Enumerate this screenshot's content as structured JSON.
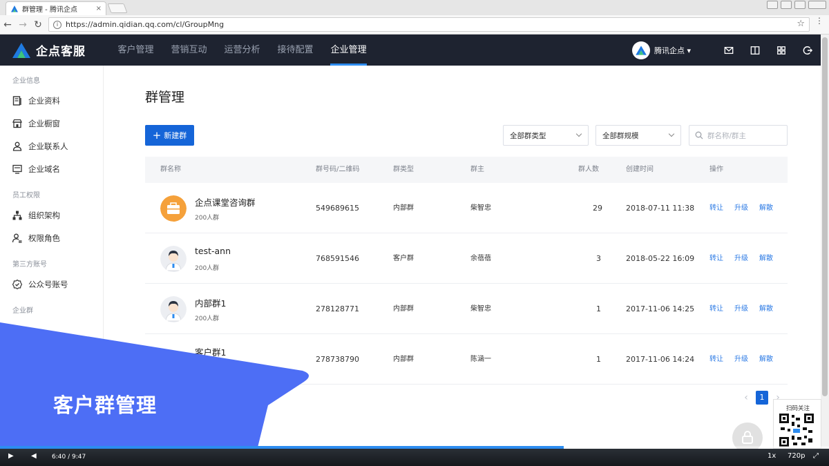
{
  "browser": {
    "tab_title": "群管理 - 腾讯企点",
    "tab_close": "×",
    "url": "https://admin.qidian.qq.com/cl/GroupMng",
    "back": "←",
    "forward": "→",
    "reload": "↻",
    "star": "☆",
    "menu": "⋮"
  },
  "topnav": {
    "brand": "企点客服",
    "items": [
      {
        "label": "客户管理"
      },
      {
        "label": "营销互动"
      },
      {
        "label": "运营分析"
      },
      {
        "label": "接待配置"
      },
      {
        "label": "企业管理"
      }
    ],
    "active_index": 4,
    "user": "腾讯企点 ▾"
  },
  "sidebar": {
    "groups": [
      {
        "title": "企业信息",
        "items": [
          {
            "label": "企业资料",
            "icon": "document-icon"
          },
          {
            "label": "企业橱窗",
            "icon": "storefront-icon"
          },
          {
            "label": "企业联系人",
            "icon": "person-icon"
          },
          {
            "label": "企业域名",
            "icon": "monitor-icon"
          }
        ]
      },
      {
        "title": "员工权限",
        "items": [
          {
            "label": "组织架构",
            "icon": "org-chart-icon"
          },
          {
            "label": "权限角色",
            "icon": "user-role-icon"
          }
        ]
      },
      {
        "title": "第三方账号",
        "items": [
          {
            "label": "公众号账号",
            "icon": "verified-badge-icon"
          }
        ]
      },
      {
        "title": "企业群",
        "items": []
      }
    ]
  },
  "main": {
    "title": "群管理",
    "new_button": "新建群",
    "filter_type": "全部群类型",
    "filter_scale": "全部群规模",
    "search_placeholder": "群名称/群主",
    "columns": [
      "群名称",
      "群号码/二维码",
      "群类型",
      "群主",
      "群人数",
      "创建时间",
      "操作"
    ],
    "rows": [
      {
        "name": "企点课堂咨询群",
        "sub": "200人群",
        "number": "549689615",
        "type": "内部群",
        "owner": "柴智忠",
        "count": "29",
        "created": "2018-07-11 11:38",
        "avatar": "briefcase-avatar"
      },
      {
        "name": "test-ann",
        "sub": "200人群",
        "number": "768591546",
        "type": "客户群",
        "owner": "余蓓蓓",
        "count": "3",
        "created": "2018-05-22 16:09",
        "avatar": "person-avatar"
      },
      {
        "name": "内部群1",
        "sub": "200人群",
        "number": "278128771",
        "type": "内部群",
        "owner": "柴智忠",
        "count": "1",
        "created": "2017-11-06 14:25",
        "avatar": "person-avatar"
      },
      {
        "name": "客户群1",
        "sub": "",
        "number": "278738790",
        "type": "内部群",
        "owner": "陈涵一",
        "count": "1",
        "created": "2017-11-06 14:24",
        "avatar": "person-avatar"
      }
    ],
    "actions": [
      "转让",
      "升级",
      "解散"
    ],
    "page": "1",
    "page_prev": "‹",
    "page_next": "›"
  },
  "overlay": {
    "banner_text": "客户群管理",
    "banner_color": "#4d6ef5",
    "qr_label": "扫码关注"
  },
  "video": {
    "play": "▶",
    "volume": "◀",
    "time": "6:40 / 9:47",
    "progress": 0.68,
    "speed": "1x",
    "quality": "720p",
    "fullscreen": "⤢"
  },
  "colors": {
    "nav_bg": "#1e2330",
    "primary": "#1565d8",
    "link": "#2d7be5"
  }
}
